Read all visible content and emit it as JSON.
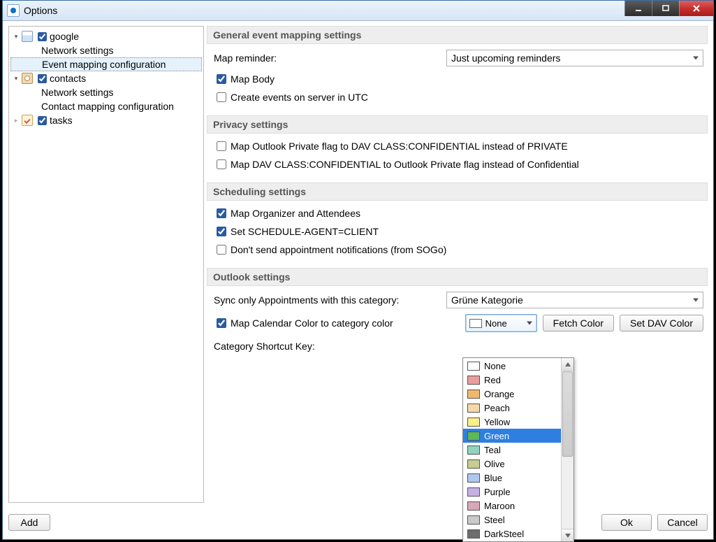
{
  "window": {
    "title": "Options"
  },
  "tree": {
    "google": {
      "label": "google",
      "checked": true,
      "children": [
        {
          "label": "Network settings"
        },
        {
          "label": "Event mapping configuration",
          "selected": true
        }
      ]
    },
    "contacts": {
      "label": "contacts",
      "checked": true,
      "children": [
        {
          "label": "Network settings"
        },
        {
          "label": "Contact mapping configuration"
        }
      ]
    },
    "tasks": {
      "label": "tasks",
      "checked": true
    }
  },
  "sections": {
    "general": {
      "title": "General event mapping settings",
      "map_reminder_label": "Map reminder:",
      "map_reminder_value": "Just upcoming reminders",
      "map_body": {
        "label": "Map Body",
        "checked": true
      },
      "create_utc": {
        "label": "Create events on server in UTC",
        "checked": false
      }
    },
    "privacy": {
      "title": "Privacy settings",
      "row1": {
        "label": "Map Outlook Private flag to DAV CLASS:CONFIDENTIAL instead of PRIVATE",
        "checked": false
      },
      "row2": {
        "label": "Map DAV CLASS:CONFIDENTIAL to Outlook Private flag instead of Confidential",
        "checked": false
      }
    },
    "scheduling": {
      "title": "Scheduling settings",
      "row1": {
        "label": "Map Organizer and Attendees",
        "checked": true
      },
      "row2": {
        "label": "Set SCHEDULE-AGENT=CLIENT",
        "checked": true
      },
      "row3": {
        "label": "Don't send appointment notifications (from SOGo)",
        "checked": false
      }
    },
    "outlook": {
      "title": "Outlook settings",
      "sync_label": "Sync only Appointments with this category:",
      "sync_value": "Grüne Kategorie",
      "map_color": {
        "label": "Map Calendar Color to category color",
        "checked": true
      },
      "color_combo_value": "None",
      "fetch_color": "Fetch Color",
      "set_dav_color": "Set DAV Color",
      "shortcut_label": "Category Shortcut Key:"
    }
  },
  "color_dropdown": {
    "selected": "Green",
    "items": [
      {
        "name": "None",
        "color": "#ffffff"
      },
      {
        "name": "Red",
        "color": "#e99d9d"
      },
      {
        "name": "Orange",
        "color": "#f0b86e"
      },
      {
        "name": "Peach",
        "color": "#f4d9a9"
      },
      {
        "name": "Yellow",
        "color": "#f9f08a"
      },
      {
        "name": "Green",
        "color": "#5bb85b"
      },
      {
        "name": "Teal",
        "color": "#8fd4c1"
      },
      {
        "name": "Olive",
        "color": "#c7cc92"
      },
      {
        "name": "Blue",
        "color": "#b0c8ef"
      },
      {
        "name": "Purple",
        "color": "#c7b0e6"
      },
      {
        "name": "Maroon",
        "color": "#d7a8b8"
      },
      {
        "name": "Steel",
        "color": "#c9c9c9"
      },
      {
        "name": "DarkSteel",
        "color": "#6d6d6d"
      }
    ]
  },
  "buttons": {
    "add": "Add",
    "ok": "Ok",
    "cancel": "Cancel"
  }
}
